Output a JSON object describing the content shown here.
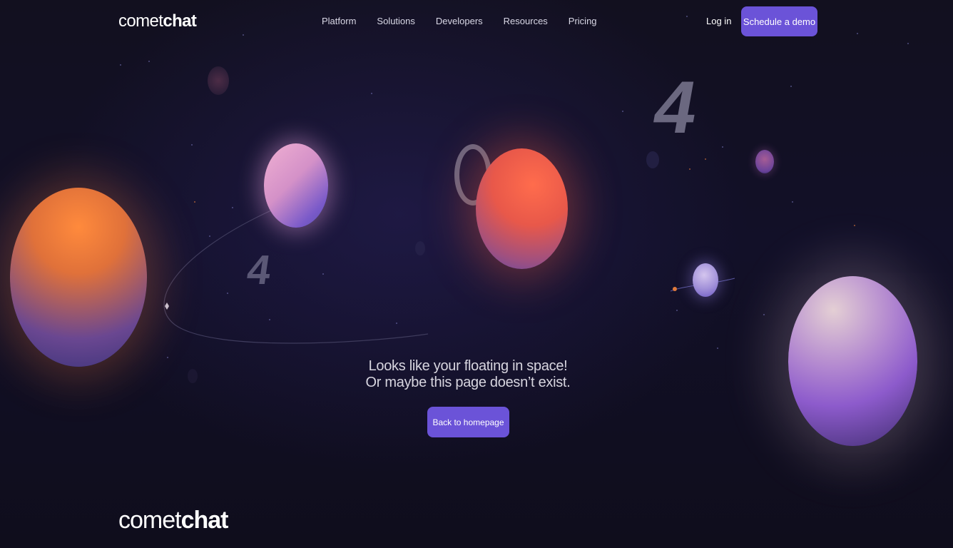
{
  "header": {
    "logo_light": "comet",
    "logo_bold": "chat",
    "nav": [
      "Platform",
      "Solutions",
      "Developers",
      "Resources",
      "Pricing"
    ],
    "login_label": "Log in",
    "demo_label": "Schedule a demo"
  },
  "error": {
    "digits": [
      "4",
      "0",
      "4"
    ],
    "line1": "Looks like your floating in space!",
    "line2": "Or maybe this page doesn’t exist.",
    "button_label": "Back to homepage"
  },
  "footer": {
    "logo_light": "comet",
    "logo_bold": "chat"
  },
  "colors": {
    "background": "#0f0d1a",
    "accent": "#6b53d8"
  }
}
